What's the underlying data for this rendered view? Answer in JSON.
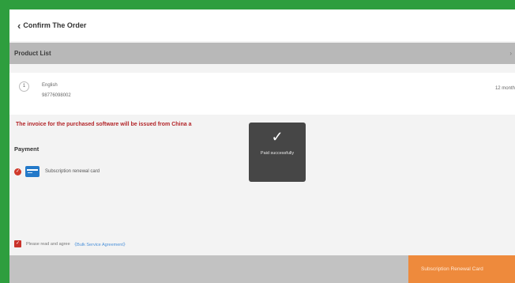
{
  "header": {
    "title": "Confirm The Order",
    "back_icon": "chevron-left-icon"
  },
  "product_list": {
    "title": "Product List",
    "more_glyph": "›",
    "items": [
      {
        "index": "1",
        "name": "English",
        "serial": "98776098002",
        "duration": "12 month"
      }
    ]
  },
  "notice": "The invoice for the purchased software will be issued from China a",
  "payment": {
    "title": "Payment",
    "method_label": "Subscription renewal card",
    "method_icon": "card-icon",
    "selected_icon": "check-radio-icon"
  },
  "toast": {
    "icon": "checkmark-icon",
    "message": "Paid successfully"
  },
  "agreement": {
    "text": "Please read and agree",
    "link": "《Bulk Service Agreement》"
  },
  "footer": {
    "pay_button_label": "Subscription Renewal Card"
  },
  "colors": {
    "frame": "#2e9e3e",
    "notice": "#b3262a",
    "accent": "#ee8a3c",
    "link": "#4a90d9",
    "card": "#2379c9"
  }
}
